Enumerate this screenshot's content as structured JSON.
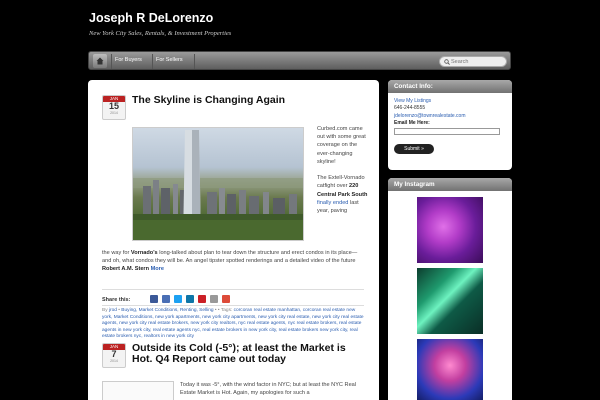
{
  "site": {
    "title": "Joseph R DeLorenzo",
    "tagline": "New York City Sales, Rentals, & Investment Properties"
  },
  "nav": {
    "items": [
      "For Buyers",
      "For Sellers"
    ],
    "search_placeholder": "Search"
  },
  "posts": [
    {
      "date": {
        "month": "JAN",
        "day": "15",
        "year": "2014"
      },
      "title": "The Skyline is Changing Again",
      "side_text": "Curbed.com came out with some great coverage on the ever-changing skyline!",
      "side_text2_a": "The Extell-Vornado catfight over ",
      "side_text2_b": "220 Central Park South",
      "side_text2_c": "finally ended",
      "side_text2_d": " last year, paving",
      "full_text_a": "the way for ",
      "full_text_b": "Vornado's",
      "full_text_c": " long-talked about plan to tear down the structure and erect condos in its place—and oh, what condos they will be. An angel tipster spotted renderings and a detailed video of the future ",
      "full_text_d": "Robert A.M. Stern",
      "full_text_e": "More",
      "share_label": "Share this:",
      "meta_prefix": "By ",
      "meta_author": "jrod",
      "meta_bullet": " • ",
      "meta_categories": "Buying, Market Conditions, Renting, Selling",
      "meta_tags_label": " • • Tags: ",
      "meta_tags": "corcoran real estate manhattan, corcoran real estate new york, Market Conditions, new york apartments, new york city apartments, new york city real estate, new york city real estate agents, new york city real estate brokers, new york city realtors, nyc real estate agents, nyc real estate brokers, real estate agents in new york city, real estate agents nyc, real estate brokers in new york city, real estate brokers new york city, real estate brokers nyc, realtors in new york city"
    },
    {
      "date": {
        "month": "JAN",
        "day": "7",
        "year": "2014"
      },
      "title": "Outside its Cold (-5°); at least the Market is Hot. Q4 Report came out today",
      "excerpt": "Today it was -5°, with the wind factor in NYC; but at least the NYC Real Estate Market is Hot. Again, my apologies for such a"
    }
  ],
  "contact": {
    "title": "Contact Info:",
    "listings_link": "View My Listings",
    "phone": "646-244-8555",
    "email": "jdelorenzo@townrealestate.com",
    "email_me_label": "Email Me Here:",
    "submit_label": "Submit »"
  },
  "instagram": {
    "title": "My Instagram"
  },
  "colors": {
    "page_bg": "#000000",
    "accent_link": "#2a5db0",
    "date_red": "#bb2222"
  }
}
